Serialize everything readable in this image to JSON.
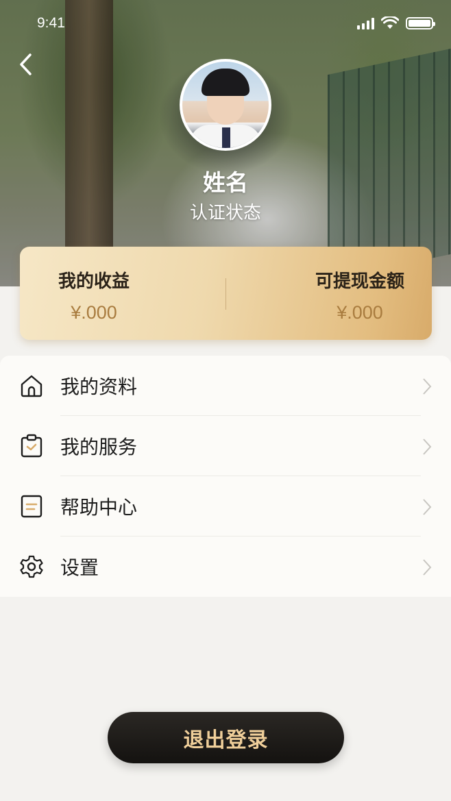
{
  "status_bar": {
    "time": "9:41"
  },
  "profile": {
    "name": "姓名",
    "status": "认证状态"
  },
  "earnings": {
    "my_income_label": "我的收益",
    "my_income_value": "¥.000",
    "withdrawable_label": "可提现金额",
    "withdrawable_value": "¥.000"
  },
  "menu": {
    "items": [
      {
        "label": "我的资料",
        "icon": "home-icon"
      },
      {
        "label": "我的服务",
        "icon": "clipboard-check-icon"
      },
      {
        "label": "帮助中心",
        "icon": "document-icon"
      },
      {
        "label": "设置",
        "icon": "gear-icon"
      }
    ]
  },
  "logout": {
    "label": "退出登录"
  },
  "colors": {
    "gold_accent": "#D8AB6A",
    "button_dark": "#1A1815",
    "button_text": "#F0CF9A"
  }
}
